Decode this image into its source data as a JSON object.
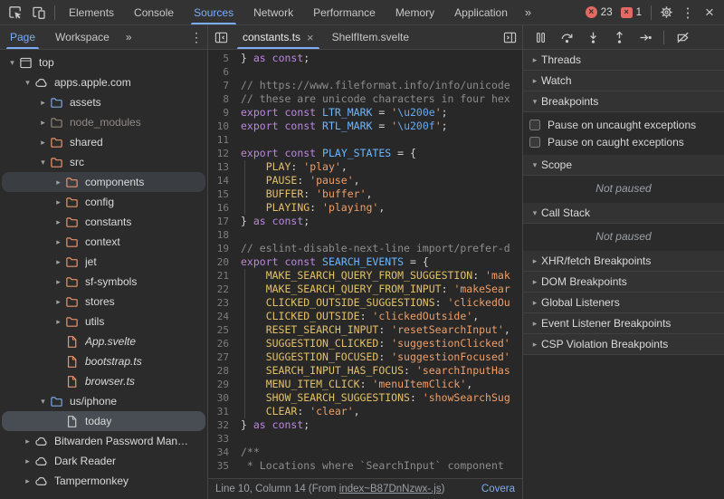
{
  "toolbar": {
    "tabs": [
      {
        "label": "Elements",
        "active": false
      },
      {
        "label": "Console",
        "active": false
      },
      {
        "label": "Sources",
        "active": true
      },
      {
        "label": "Network",
        "active": false
      },
      {
        "label": "Performance",
        "active": false
      },
      {
        "label": "Memory",
        "active": false
      },
      {
        "label": "Application",
        "active": false
      }
    ],
    "more_tabs_label": "»",
    "error_count": "23",
    "issue_count": "1",
    "colors": {
      "accent": "#7cacf8",
      "error": "#e46962"
    }
  },
  "navigator": {
    "tabs": [
      {
        "label": "Page",
        "active": true
      },
      {
        "label": "Workspace",
        "active": false
      }
    ],
    "more_label": "»",
    "tree": [
      {
        "label": "top",
        "depth": 0,
        "icon": "frame",
        "arrow": "exp"
      },
      {
        "label": "apps.apple.com",
        "depth": 1,
        "icon": "cloud",
        "arrow": "exp"
      },
      {
        "label": "assets",
        "depth": 2,
        "icon": "folder-blue",
        "arrow": "col"
      },
      {
        "label": "node_modules",
        "depth": 2,
        "icon": "folder-muted",
        "arrow": "col",
        "muted": true
      },
      {
        "label": "shared",
        "depth": 2,
        "icon": "folder",
        "arrow": "col"
      },
      {
        "label": "src",
        "depth": 2,
        "icon": "folder",
        "arrow": "exp"
      },
      {
        "label": "components",
        "depth": 3,
        "icon": "folder",
        "arrow": "col",
        "hovered": true
      },
      {
        "label": "config",
        "depth": 3,
        "icon": "folder",
        "arrow": "col"
      },
      {
        "label": "constants",
        "depth": 3,
        "icon": "folder",
        "arrow": "col"
      },
      {
        "label": "context",
        "depth": 3,
        "icon": "folder",
        "arrow": "col"
      },
      {
        "label": "jet",
        "depth": 3,
        "icon": "folder",
        "arrow": "col"
      },
      {
        "label": "sf-symbols",
        "depth": 3,
        "icon": "folder",
        "arrow": "col"
      },
      {
        "label": "stores",
        "depth": 3,
        "icon": "folder",
        "arrow": "col"
      },
      {
        "label": "utils",
        "depth": 3,
        "icon": "folder",
        "arrow": "col"
      },
      {
        "label": "App.svelte",
        "depth": 3,
        "icon": "file",
        "italic": true
      },
      {
        "label": "bootstrap.ts",
        "depth": 3,
        "icon": "file",
        "italic": true
      },
      {
        "label": "browser.ts",
        "depth": 3,
        "icon": "file",
        "italic": true
      },
      {
        "label": "us/iphone",
        "depth": 2,
        "icon": "folder-blue",
        "arrow": "exp"
      },
      {
        "label": "today",
        "depth": 3,
        "icon": "file-plain",
        "selected": true
      },
      {
        "label": "Bitwarden Password Man…",
        "depth": 1,
        "icon": "cloud",
        "arrow": "col"
      },
      {
        "label": "Dark Reader",
        "depth": 1,
        "icon": "cloud",
        "arrow": "col"
      },
      {
        "label": "Tampermonkey",
        "depth": 1,
        "icon": "cloud",
        "arrow": "col"
      }
    ]
  },
  "editor": {
    "tabs": [
      {
        "label": "constants.ts",
        "active": true,
        "closable": true
      },
      {
        "label": "ShelfItem.svelte",
        "active": false,
        "closable": false
      }
    ],
    "lines": [
      {
        "n": "5",
        "segs": [
          [
            "pn",
            "} "
          ],
          [
            "kw",
            "as"
          ],
          [
            "pn",
            " "
          ],
          [
            "kw",
            "const"
          ],
          [
            "pn",
            ";"
          ]
        ]
      },
      {
        "n": "6",
        "segs": []
      },
      {
        "n": "7",
        "segs": [
          [
            "com",
            "// https://www.fileformat.info/info/unicode"
          ]
        ]
      },
      {
        "n": "8",
        "segs": [
          [
            "com",
            "// these are unicode characters in four hex"
          ]
        ]
      },
      {
        "n": "9",
        "segs": [
          [
            "kw",
            "export"
          ],
          [
            "pn",
            " "
          ],
          [
            "kw",
            "const"
          ],
          [
            "pn",
            " "
          ],
          [
            "def",
            "LTR_MARK"
          ],
          [
            "op",
            " = "
          ],
          [
            "str",
            "'"
          ],
          [
            "esc",
            "\\u200e"
          ],
          [
            "str",
            "'"
          ],
          [
            "pn",
            ";"
          ]
        ]
      },
      {
        "n": "10",
        "segs": [
          [
            "kw",
            "export"
          ],
          [
            "pn",
            " "
          ],
          [
            "kw",
            "const"
          ],
          [
            "pn",
            " "
          ],
          [
            "def",
            "RTL_MARK"
          ],
          [
            "op",
            " = "
          ],
          [
            "str",
            "'"
          ],
          [
            "esc",
            "\\u200f"
          ],
          [
            "str",
            "'"
          ],
          [
            "pn",
            ";"
          ]
        ]
      },
      {
        "n": "11",
        "segs": []
      },
      {
        "n": "12",
        "segs": [
          [
            "kw",
            "export"
          ],
          [
            "pn",
            " "
          ],
          [
            "kw",
            "const"
          ],
          [
            "pn",
            " "
          ],
          [
            "def",
            "PLAY_STATES"
          ],
          [
            "op",
            " = "
          ],
          [
            "pn",
            "{"
          ]
        ]
      },
      {
        "n": "13",
        "guide": true,
        "segs": [
          [
            "pn",
            "    "
          ],
          [
            "prop",
            "PLAY"
          ],
          [
            "pn",
            ": "
          ],
          [
            "str",
            "'play'"
          ],
          [
            "pn",
            ","
          ]
        ]
      },
      {
        "n": "14",
        "guide": true,
        "segs": [
          [
            "pn",
            "    "
          ],
          [
            "prop",
            "PAUSE"
          ],
          [
            "pn",
            ": "
          ],
          [
            "str",
            "'pause'"
          ],
          [
            "pn",
            ","
          ]
        ]
      },
      {
        "n": "15",
        "guide": true,
        "segs": [
          [
            "pn",
            "    "
          ],
          [
            "prop",
            "BUFFER"
          ],
          [
            "pn",
            ": "
          ],
          [
            "str",
            "'buffer'"
          ],
          [
            "pn",
            ","
          ]
        ]
      },
      {
        "n": "16",
        "guide": true,
        "segs": [
          [
            "pn",
            "    "
          ],
          [
            "prop",
            "PLAYING"
          ],
          [
            "pn",
            ": "
          ],
          [
            "str",
            "'playing'"
          ],
          [
            "pn",
            ","
          ]
        ]
      },
      {
        "n": "17",
        "segs": [
          [
            "pn",
            "} "
          ],
          [
            "kw",
            "as"
          ],
          [
            "pn",
            " "
          ],
          [
            "kw",
            "const"
          ],
          [
            "pn",
            ";"
          ]
        ]
      },
      {
        "n": "18",
        "segs": []
      },
      {
        "n": "19",
        "segs": [
          [
            "com",
            "// eslint-disable-next-line import/prefer-d"
          ]
        ]
      },
      {
        "n": "20",
        "segs": [
          [
            "kw",
            "export"
          ],
          [
            "pn",
            " "
          ],
          [
            "kw",
            "const"
          ],
          [
            "pn",
            " "
          ],
          [
            "def",
            "SEARCH_EVENTS"
          ],
          [
            "op",
            " = "
          ],
          [
            "pn",
            "{"
          ]
        ]
      },
      {
        "n": "21",
        "guide": true,
        "segs": [
          [
            "pn",
            "    "
          ],
          [
            "prop",
            "MAKE_SEARCH_QUERY_FROM_SUGGESTION"
          ],
          [
            "pn",
            ": "
          ],
          [
            "str",
            "'mak"
          ]
        ]
      },
      {
        "n": "22",
        "guide": true,
        "segs": [
          [
            "pn",
            "    "
          ],
          [
            "prop",
            "MAKE_SEARCH_QUERY_FROM_INPUT"
          ],
          [
            "pn",
            ": "
          ],
          [
            "str",
            "'makeSear"
          ]
        ]
      },
      {
        "n": "23",
        "guide": true,
        "segs": [
          [
            "pn",
            "    "
          ],
          [
            "prop",
            "CLICKED_OUTSIDE_SUGGESTIONS"
          ],
          [
            "pn",
            ": "
          ],
          [
            "str",
            "'clickedOu"
          ]
        ]
      },
      {
        "n": "24",
        "guide": true,
        "segs": [
          [
            "pn",
            "    "
          ],
          [
            "prop",
            "CLICKED_OUTSIDE"
          ],
          [
            "pn",
            ": "
          ],
          [
            "str",
            "'clickedOutside'"
          ],
          [
            "pn",
            ","
          ]
        ]
      },
      {
        "n": "25",
        "guide": true,
        "segs": [
          [
            "pn",
            "    "
          ],
          [
            "prop",
            "RESET_SEARCH_INPUT"
          ],
          [
            "pn",
            ": "
          ],
          [
            "str",
            "'resetSearchInput'"
          ],
          [
            "pn",
            ","
          ]
        ]
      },
      {
        "n": "26",
        "guide": true,
        "segs": [
          [
            "pn",
            "    "
          ],
          [
            "prop",
            "SUGGESTION_CLICKED"
          ],
          [
            "pn",
            ": "
          ],
          [
            "str",
            "'suggestionClicked'"
          ]
        ]
      },
      {
        "n": "27",
        "guide": true,
        "segs": [
          [
            "pn",
            "    "
          ],
          [
            "prop",
            "SUGGESTION_FOCUSED"
          ],
          [
            "pn",
            ": "
          ],
          [
            "str",
            "'suggestionFocused'"
          ]
        ]
      },
      {
        "n": "28",
        "guide": true,
        "segs": [
          [
            "pn",
            "    "
          ],
          [
            "prop",
            "SEARCH_INPUT_HAS_FOCUS"
          ],
          [
            "pn",
            ": "
          ],
          [
            "str",
            "'searchInputHas"
          ]
        ]
      },
      {
        "n": "29",
        "guide": true,
        "segs": [
          [
            "pn",
            "    "
          ],
          [
            "prop",
            "MENU_ITEM_CLICK"
          ],
          [
            "pn",
            ": "
          ],
          [
            "str",
            "'menuItemClick'"
          ],
          [
            "pn",
            ","
          ]
        ]
      },
      {
        "n": "30",
        "guide": true,
        "segs": [
          [
            "pn",
            "    "
          ],
          [
            "prop",
            "SHOW_SEARCH_SUGGESTIONS"
          ],
          [
            "pn",
            ": "
          ],
          [
            "str",
            "'showSearchSug"
          ]
        ]
      },
      {
        "n": "31",
        "guide": true,
        "segs": [
          [
            "pn",
            "    "
          ],
          [
            "prop",
            "CLEAR"
          ],
          [
            "pn",
            ": "
          ],
          [
            "str",
            "'clear'"
          ],
          [
            "pn",
            ","
          ]
        ]
      },
      {
        "n": "32",
        "segs": [
          [
            "pn",
            "} "
          ],
          [
            "kw",
            "as"
          ],
          [
            "pn",
            " "
          ],
          [
            "kw",
            "const"
          ],
          [
            "pn",
            ";"
          ]
        ]
      },
      {
        "n": "33",
        "segs": []
      },
      {
        "n": "34",
        "segs": [
          [
            "com",
            "/**"
          ]
        ]
      },
      {
        "n": "35",
        "segs": [
          [
            "com",
            " * Locations where `SearchInput` component"
          ]
        ]
      }
    ],
    "status": {
      "prefix": "Line 10, Column 14 (From ",
      "link": "index~B87DnNzwx-.js",
      "suffix": ")",
      "coverage": "Covera"
    }
  },
  "debugger": {
    "toolbar": [
      "pause",
      "step-over",
      "step-into",
      "step-out",
      "step",
      "divider",
      "deactivate-breakpoints"
    ],
    "sections": [
      {
        "label": "Threads",
        "state": "col"
      },
      {
        "label": "Watch",
        "state": "col"
      },
      {
        "label": "Breakpoints",
        "state": "exp",
        "checkboxes": [
          "Pause on uncaught exceptions",
          "Pause on caught exceptions"
        ]
      },
      {
        "label": "Scope",
        "state": "exp",
        "message": "Not paused"
      },
      {
        "label": "Call Stack",
        "state": "exp",
        "message": "Not paused"
      },
      {
        "label": "XHR/fetch Breakpoints",
        "state": "col"
      },
      {
        "label": "DOM Breakpoints",
        "state": "col"
      },
      {
        "label": "Global Listeners",
        "state": "col"
      },
      {
        "label": "Event Listener Breakpoints",
        "state": "col"
      },
      {
        "label": "CSP Violation Breakpoints",
        "state": "col"
      }
    ]
  }
}
